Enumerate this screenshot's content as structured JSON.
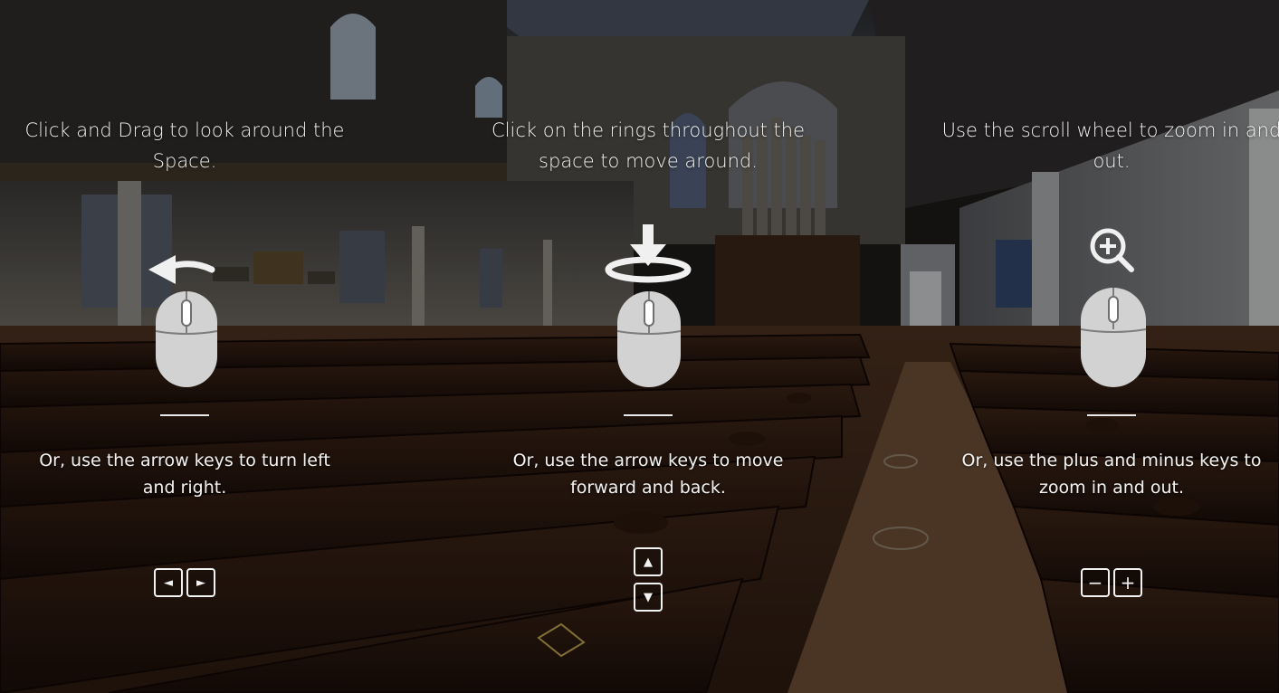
{
  "panels": [
    {
      "title": "Click and Drag to look around the Space.",
      "subtitle": "Or, use the arrow keys to turn left and right.",
      "graphic_icon": "mouse-drag-icon",
      "keys": [
        {
          "name": "left-arrow-key",
          "glyph": "◄"
        },
        {
          "name": "right-arrow-key",
          "glyph": "►"
        }
      ]
    },
    {
      "title": "Click on the rings throughout the space to move around.",
      "subtitle": "Or, use the arrow keys to move forward and back.",
      "graphic_icon": "mouse-click-ring-icon",
      "keys": [
        {
          "name": "up-arrow-key",
          "glyph": "▲"
        },
        {
          "name": "down-arrow-key",
          "glyph": "▼"
        }
      ]
    },
    {
      "title": "Use the scroll wheel to zoom in and out.",
      "subtitle": "Or, use the plus and minus keys to zoom in and out.",
      "graphic_icon": "mouse-scroll-zoom-icon",
      "keys": [
        {
          "name": "minus-key",
          "glyph": "−"
        },
        {
          "name": "plus-key",
          "glyph": "+"
        }
      ]
    }
  ],
  "colors": {
    "text": "#f2f2f2",
    "mouse_body": "#cfcfcf",
    "overlay": "rgba(0,0,0,0.30)"
  }
}
